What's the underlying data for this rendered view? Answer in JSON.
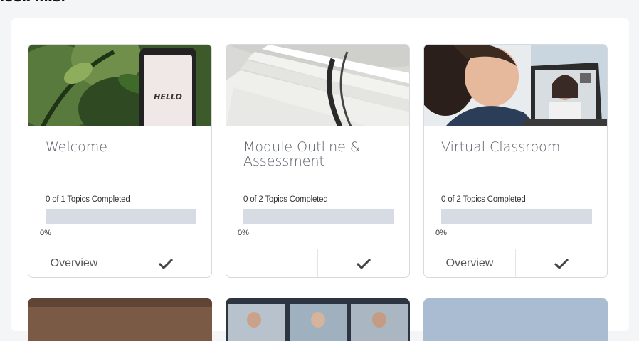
{
  "page_heading": "look like:",
  "cards": [
    {
      "title": "Welcome",
      "progress_text": "0 of 1 Topics Completed",
      "progress": 0,
      "percent_label": "0%",
      "overview_label": "Overview",
      "check_icon": "checkmark-icon",
      "image_label": "HELLO"
    },
    {
      "title": "Module Outline & Assessment",
      "progress_text": "0 of 2 Topics Completed",
      "progress": 0,
      "percent_label": "0%",
      "overview_label": "",
      "check_icon": "checkmark-icon"
    },
    {
      "title": "Virtual Classroom",
      "progress_text": "0 of 2 Topics Completed",
      "progress": 0,
      "percent_label": "0%",
      "overview_label": "Overview",
      "check_icon": "checkmark-icon"
    }
  ],
  "colors": {
    "progress_track": "#d7dbe3",
    "card_border": "#d6d9de",
    "title_text": "#5a6068",
    "background": "#f4f5f7"
  }
}
